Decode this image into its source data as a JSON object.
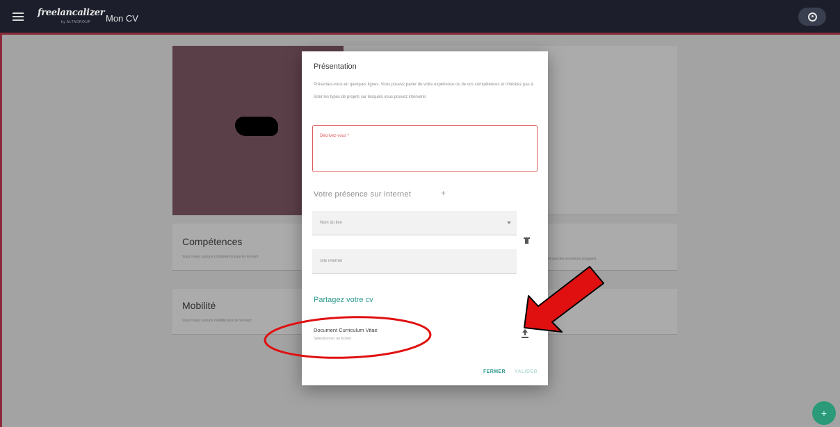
{
  "topbar": {
    "logo_text": "freelancalizer",
    "logo_subtext": "by ALTAGROUP",
    "app_title": "Mon CV"
  },
  "background": {
    "skills_title": "Compétences",
    "skills_text": "Vous n'avez aucune compétence pour le moment",
    "skills_text_right": "et que des recruteurs engagent",
    "mobility_title": "Mobilité",
    "mobility_text": "Vous n'avez aucune mobilité pour le moment",
    "fab_label": "+"
  },
  "dialog": {
    "title": "Présentation",
    "description": "Présentez-vous en quelques lignes. Vous pouvez parler de votre expérience ou de vos compétences et n'hésitez pas à lister les types de projets sur lesquels vous pouvez intervenir.",
    "about_label": "Décrivez-vous *",
    "internet_title": "Votre présence sur internet",
    "add_link_label": "+",
    "link_type_label": "Nom du lien",
    "website_placeholder": "Site internet",
    "share_title": "Partagez votre cv",
    "doc_title": "Document Curriculum Vitae",
    "doc_subtitle": "Sélectionner un fichier",
    "close_label": "FERMER",
    "validate_label": "VALIDER"
  },
  "colors": {
    "topbar": "#1c1f2b",
    "accent": "#2f9b8e",
    "error": "#e05a5a",
    "annotation": "#e01010"
  },
  "icons": {
    "menu": "menu-icon",
    "account": "account-icon",
    "add_link": "plus-icon",
    "delete": "trash-icon",
    "upload": "upload-icon",
    "fab": "plus-icon"
  }
}
